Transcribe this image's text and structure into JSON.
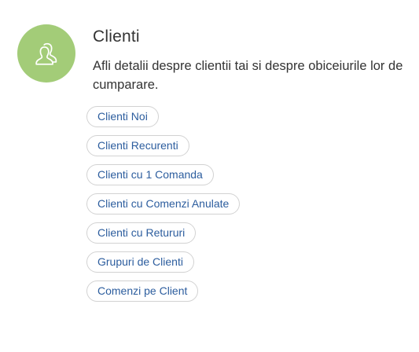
{
  "section": {
    "icon": "users-icon",
    "icon_bg_color": "#a3cc78",
    "title": "Clienti",
    "description": "Afli detalii despre clientii tai si despre obiceiurile lor de cumparare."
  },
  "links": [
    {
      "label": "Clienti Noi"
    },
    {
      "label": "Clienti Recurenti"
    },
    {
      "label": "Clienti cu 1 Comanda"
    },
    {
      "label": "Clienti cu Comenzi Anulate"
    },
    {
      "label": "Clienti cu Retururi"
    },
    {
      "label": "Grupuri de Clienti"
    },
    {
      "label": "Comenzi pe Client"
    }
  ],
  "colors": {
    "link_text": "#2c5d9e",
    "pill_border": "#d2d2d2"
  }
}
